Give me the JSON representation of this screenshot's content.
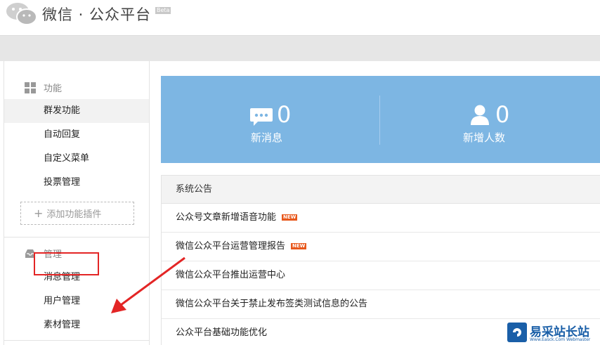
{
  "header": {
    "title": "微信 · 公众平台",
    "beta": "Beta"
  },
  "sidebar": {
    "section_function": "功能",
    "function_items": [
      "群发功能",
      "自动回复",
      "自定义菜单",
      "投票管理"
    ],
    "add_plugin": "添加功能插件",
    "section_manage": "管理",
    "manage_items": [
      "消息管理",
      "用户管理",
      "素材管理"
    ]
  },
  "stats": {
    "messages": {
      "value": "0",
      "label": "新消息"
    },
    "users": {
      "value": "0",
      "label": "新增人数"
    }
  },
  "notice": {
    "title": "系统公告",
    "new_badge": "NEW",
    "items": [
      "公众号文章新增语音功能",
      "微信公众平台运营管理报告",
      "微信公众平台推出运营中心",
      "微信公众平台关于禁止发布签类测试信息的公告",
      "公众平台基础功能优化"
    ]
  },
  "watermark": {
    "text": "易采站长站",
    "sub": "Www.Easck.Com Webmaster"
  },
  "colors": {
    "stats_bg": "#7db6e3",
    "highlight": "#e32525",
    "new_badge": "#e8581c"
  }
}
